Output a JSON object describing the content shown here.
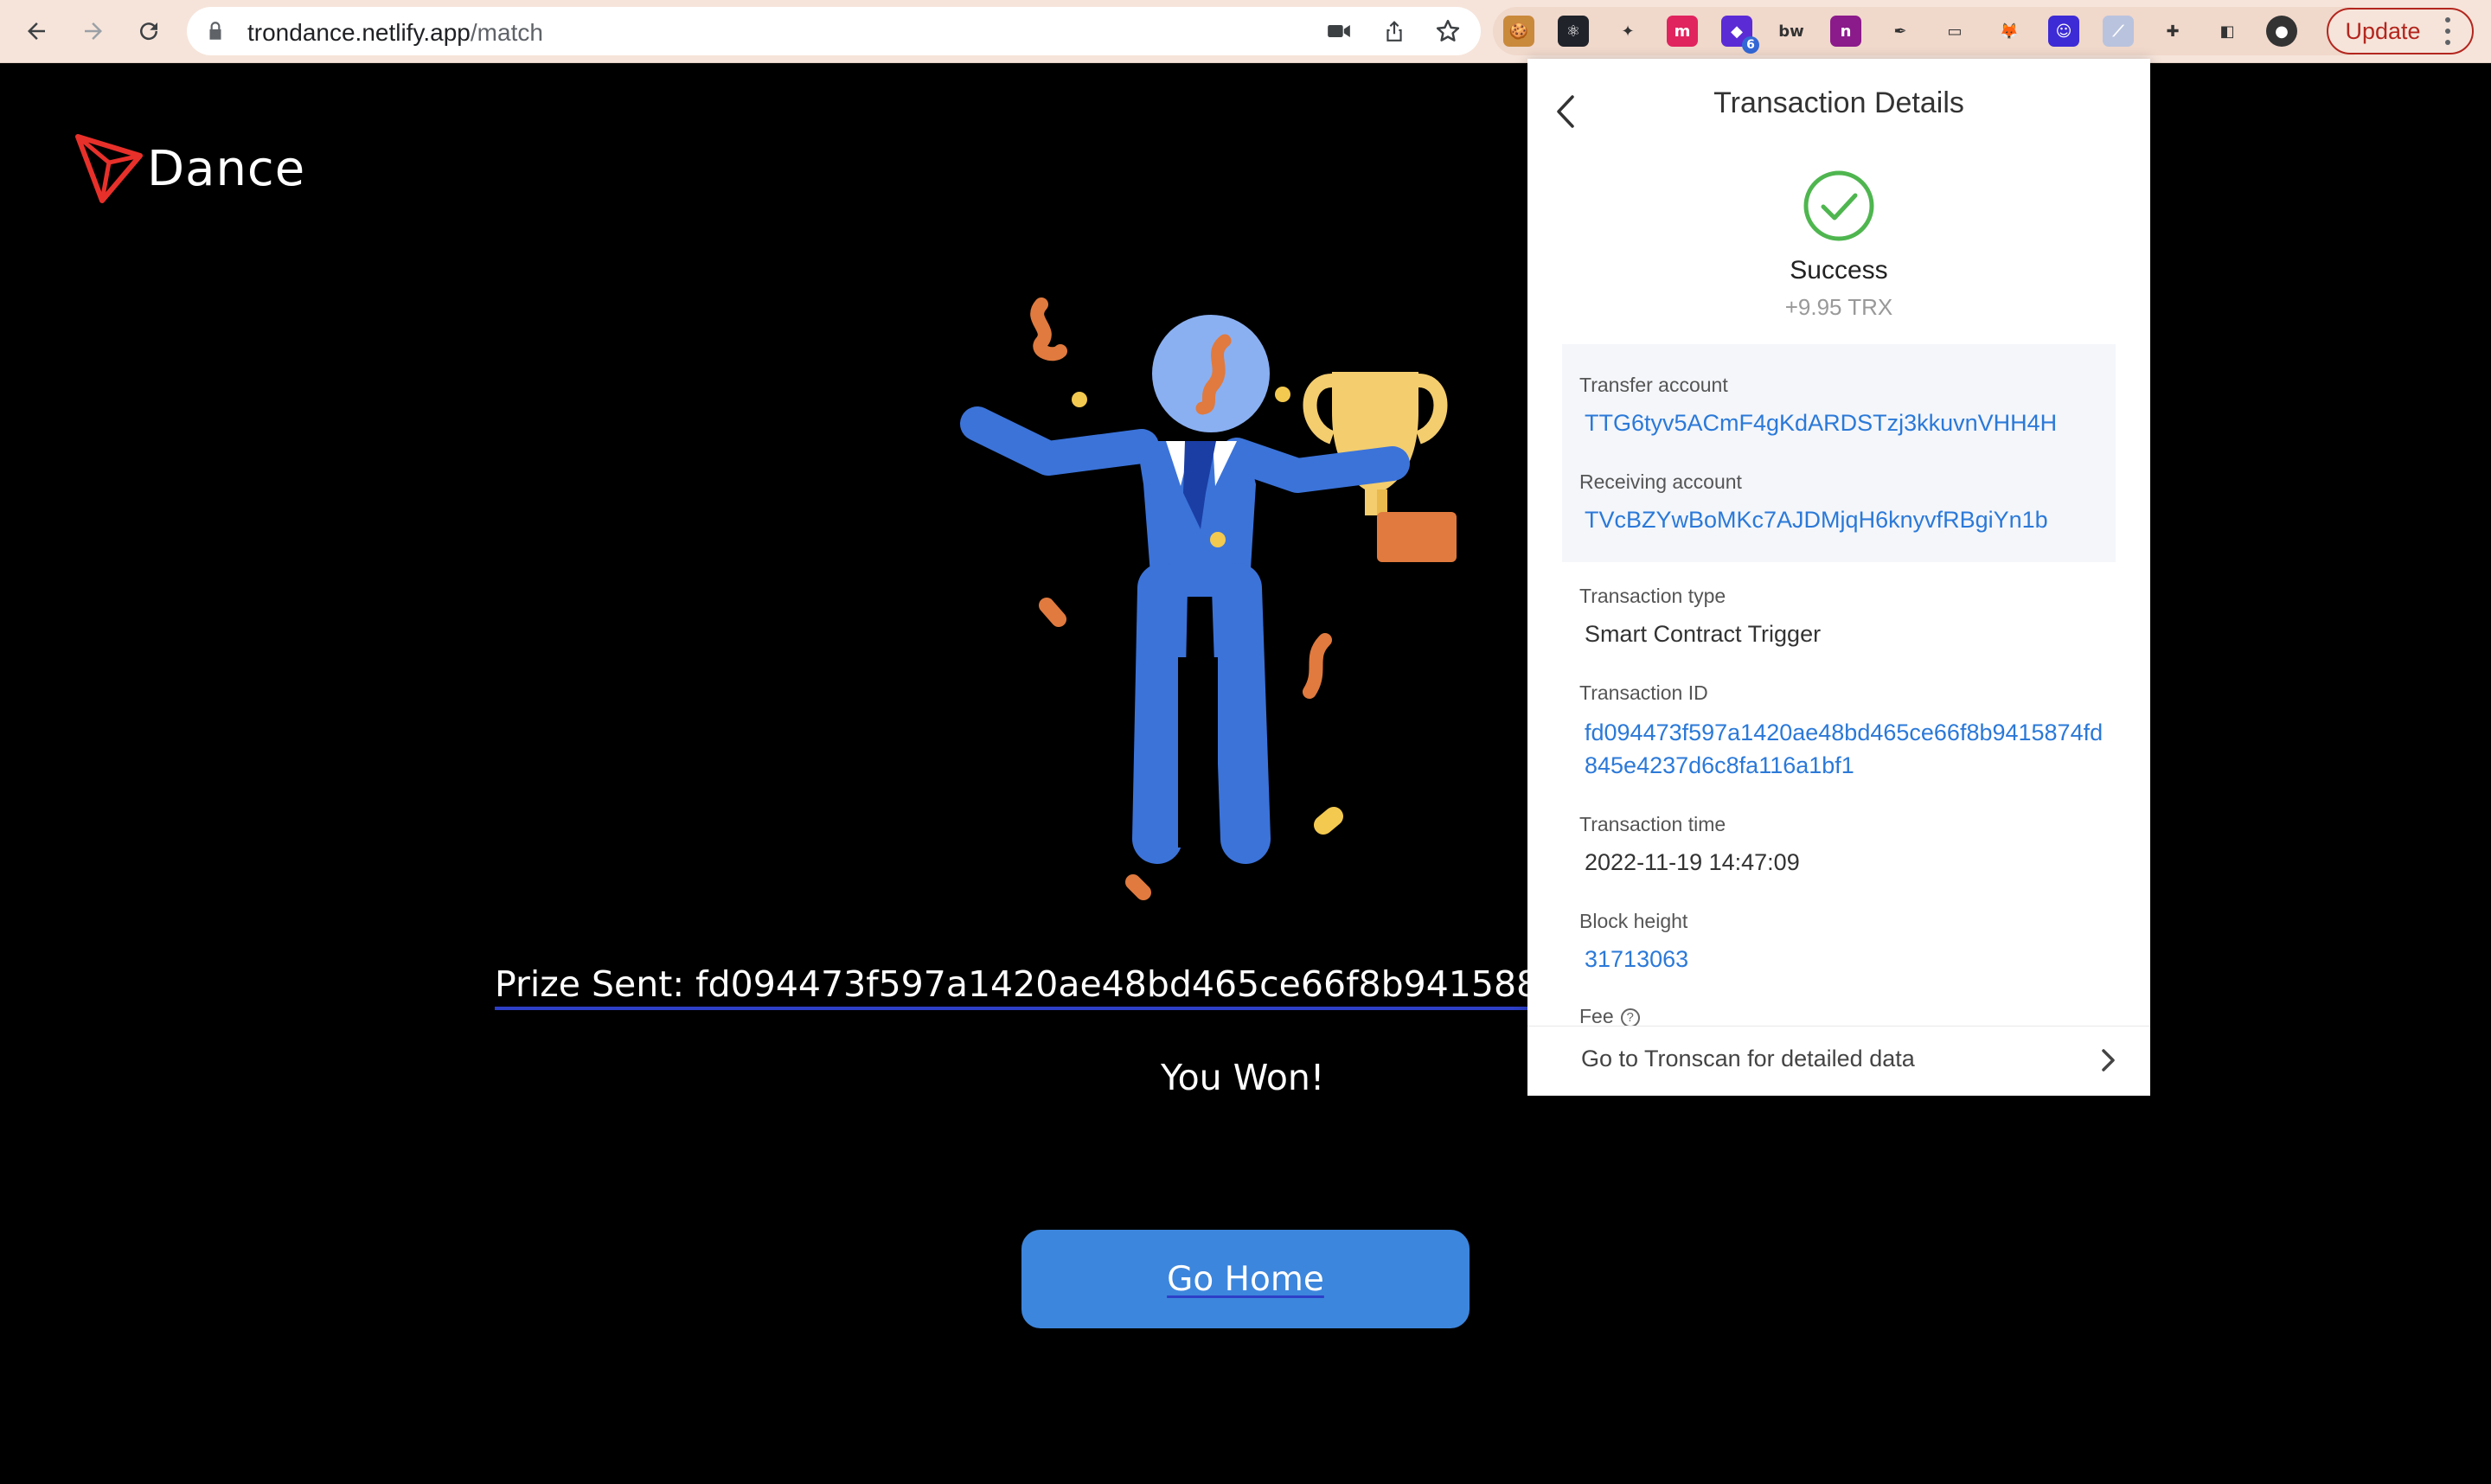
{
  "browser": {
    "url_host": "trondance.netlify.app",
    "url_path": "/match",
    "update_label": "Update",
    "extensions": [
      {
        "name": "cookie-icon",
        "color": "#c98a3c",
        "glyph": "🍪"
      },
      {
        "name": "react-devtools-icon",
        "color": "#20232a",
        "glyph": "⚛"
      },
      {
        "name": "sparkle-icon",
        "color": "#f0d8cb",
        "glyph": "✦"
      },
      {
        "name": "m-circle-icon",
        "color": "#e0245e",
        "glyph": "m"
      },
      {
        "name": "cube-icon",
        "color": "#5b2bd6",
        "glyph": "◆",
        "badge": "6"
      },
      {
        "name": "bw-icon",
        "color": "#f0d8cb",
        "glyph": "bw"
      },
      {
        "name": "n-block-icon",
        "color": "#8b1a8b",
        "glyph": "n"
      },
      {
        "name": "eyedropper-icon",
        "color": "#f0d8cb",
        "glyph": "✒"
      },
      {
        "name": "screen-icon",
        "color": "#f0d8cb",
        "glyph": "▭"
      },
      {
        "name": "metamask-icon",
        "color": "#f0d8cb",
        "glyph": "🦊"
      },
      {
        "name": "face-icon",
        "color": "#3d2bd6",
        "glyph": "☺"
      },
      {
        "name": "tronlink-icon",
        "color": "#b9c3de",
        "glyph": "⟋"
      },
      {
        "name": "puzzle-icon",
        "color": "#f0d8cb",
        "glyph": "✚"
      },
      {
        "name": "sidepanel-icon",
        "color": "#f0d8cb",
        "glyph": "◧"
      },
      {
        "name": "profile-avatar-icon",
        "color": "#333333",
        "glyph": "●"
      }
    ]
  },
  "page": {
    "logo_text": "Dance",
    "prize_text": "Prize Sent: fd094473f597a1420ae48bd465ce66f8b94158874fd845e4237d6c8fa116a1bf1",
    "won_text": "You Won!",
    "go_home_label": "Go Home"
  },
  "popup": {
    "title": "Transaction Details",
    "status": "Success",
    "amount": "+9.95 TRX",
    "transfer_label": "Transfer account",
    "transfer_value": "TTG6tyv5ACmF4gKdARDSTzj3kkuvnVHH4H",
    "receiving_label": "Receiving account",
    "receiving_value": "TVcBZYwBoMKc7AJDMjqH6knyvfRBgiYn1b",
    "type_label": "Transaction type",
    "type_value": "Smart Contract Trigger",
    "id_label": "Transaction ID",
    "id_value": "fd094473f597a1420ae48bd465ce66f8b9415874fd845e4237d6c8fa116a1bf1",
    "time_label": "Transaction time",
    "time_value": "2022-11-19 14:47:09",
    "block_label": "Block height",
    "block_value": "31713063",
    "fee_label": "Fee",
    "footer_label": "Go to Tronscan for detailed data"
  }
}
